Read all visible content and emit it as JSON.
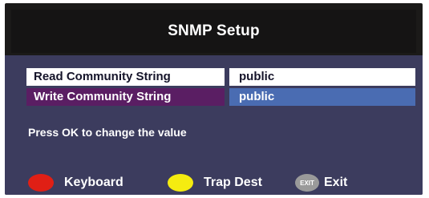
{
  "header": {
    "title": "SNMP Setup"
  },
  "settings": {
    "rows": [
      {
        "label": "Read Community String",
        "value": "public"
      },
      {
        "label": "Write Community String",
        "value": "public"
      }
    ]
  },
  "hint": "Press OK to change the value",
  "footer": {
    "keyboard": {
      "label": "Keyboard",
      "color": "#e01f15"
    },
    "trap_dest": {
      "label": "Trap Dest",
      "color": "#f5ec10"
    },
    "exit": {
      "icon_text": "EXIT",
      "label": "Exit"
    }
  },
  "colors": {
    "panel": "#3c3c5e",
    "selected_label": "#5a1e63",
    "selected_value": "#4a6cb2"
  }
}
